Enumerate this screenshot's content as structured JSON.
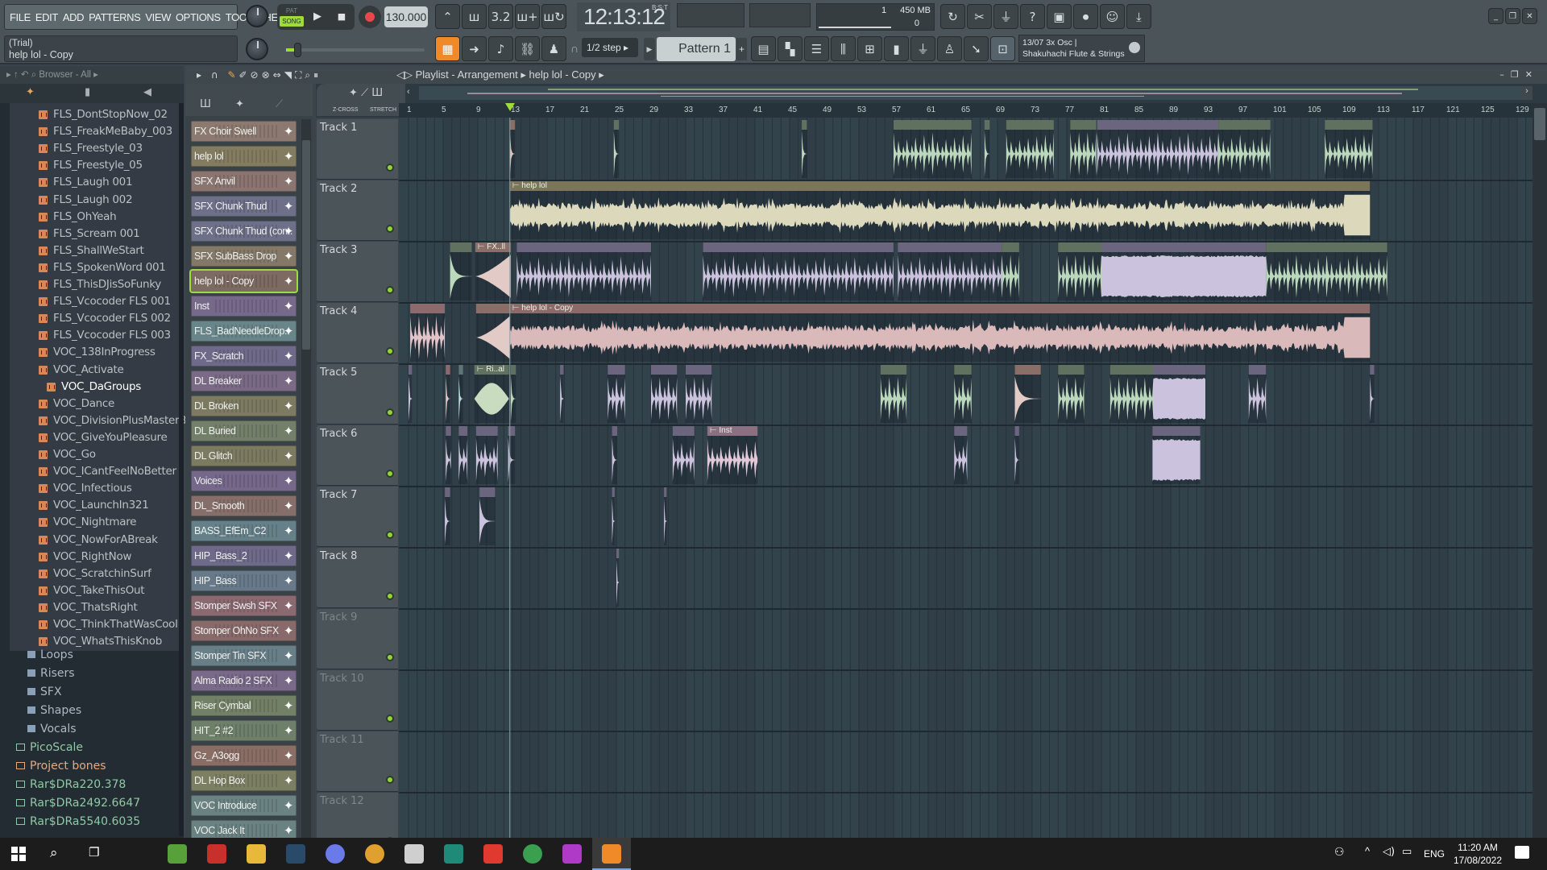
{
  "menu": [
    "FILE",
    "EDIT",
    "ADD",
    "PATTERNS",
    "VIEW",
    "OPTIONS",
    "TOOLS",
    "HELP"
  ],
  "transport": {
    "pat": "PAT",
    "song": "SONG",
    "tempo": "130.000",
    "time": "12:13:12",
    "time_label": "B:S:T"
  },
  "cpu": {
    "cpu_value": "1",
    "memory": "450 MB",
    "polyphony": "0"
  },
  "hint": {
    "line1": "(Trial)",
    "line2": "help lol - Copy"
  },
  "snap": "1/2 step",
  "pattern": "Pattern 1",
  "news": {
    "line1": "13/07  3x Osc |",
    "line2": "Shakuhachi Flute & Strings"
  },
  "browser": {
    "title": "Browser - All",
    "items": [
      "FLS_DontStopNow_02",
      "FLS_FreakMeBaby_003",
      "FLS_Freestyle_03",
      "FLS_Freestyle_05",
      "FLS_Laugh 001",
      "FLS_Laugh 002",
      "FLS_OhYeah",
      "FLS_Scream 001",
      "FLS_ShallWeStart",
      "FLS_SpokenWord 001",
      "FLS_ThisDJisSoFunky",
      "FLS_Vcocoder FLS 001",
      "FLS_Vcocoder FLS 002",
      "FLS_Vcocoder FLS 003",
      "VOC_138InProgress",
      "VOC_Activate",
      "VOC_DaGroups",
      "VOC_Dance",
      "VOC_DivisionPlusMasterBeat",
      "VOC_GiveYouPleasure",
      "VOC_Go",
      "VOC_ICantFeelNoBetter",
      "VOC_Infectious",
      "VOC_LaunchIn321",
      "VOC_Nightmare",
      "VOC_NowForABreak",
      "VOC_RightNow",
      "VOC_ScratchinSurf",
      "VOC_TakeThisOut",
      "VOC_ThatsRight",
      "VOC_ThinkThatWasCool",
      "VOC_WhatsThisKnob"
    ],
    "selected": "VOC_DaGroups",
    "subfolders": [
      "Loops",
      "Risers",
      "SFX",
      "Shapes",
      "Vocals"
    ],
    "folders": [
      {
        "name": "PicoScale",
        "color": "#8fcaa6"
      },
      {
        "name": "Project bones",
        "color": "#e3aa82"
      },
      {
        "name": "Rar$DRa220.378",
        "color": "#8fcaa6"
      },
      {
        "name": "Rar$DRa2492.6647",
        "color": "#8fcaa6"
      },
      {
        "name": "Rar$DRa5540.6035",
        "color": "#8fcaa6"
      }
    ]
  },
  "channels": [
    {
      "name": "FX Choir Swell",
      "color": "#8c7a70"
    },
    {
      "name": "help lol",
      "color": "#837c60"
    },
    {
      "name": "SFX Anvil",
      "color": "#8a7570"
    },
    {
      "name": "SFX Chunk Thud",
      "color": "#6e6f88"
    },
    {
      "name": "SFX Chunk Thud (con..",
      "color": "#6e6f88"
    },
    {
      "name": "SFX SubBass Drop",
      "color": "#847969"
    },
    {
      "name": "help lol - Copy",
      "color": "#7d6a63",
      "selected": true
    },
    {
      "name": "Inst",
      "color": "#76698a"
    },
    {
      "name": "FLS_BadNeedleDrop..",
      "color": "#68868a"
    },
    {
      "name": "FX_Scratch",
      "color": "#6f6a8a"
    },
    {
      "name": "DL Breaker",
      "color": "#7a6a86"
    },
    {
      "name": "DL Broken",
      "color": "#7d7a62"
    },
    {
      "name": "DL Buried",
      "color": "#737f69"
    },
    {
      "name": "DL Glitch",
      "color": "#7d7a62"
    },
    {
      "name": "Voices",
      "color": "#75688a"
    },
    {
      "name": "DL_Smooth",
      "color": "#866f6b"
    },
    {
      "name": "BASS_EfEm_C2",
      "color": "#66808a"
    },
    {
      "name": "HIP_Bass_2",
      "color": "#6f6a8a"
    },
    {
      "name": "HIP_Bass",
      "color": "#687a8a"
    },
    {
      "name": "Stomper Swsh SFX",
      "color": "#8a6a70"
    },
    {
      "name": "Stomper OhNo SFX",
      "color": "#896a6a"
    },
    {
      "name": "Stomper Tin SFX",
      "color": "#687f88"
    },
    {
      "name": "Alma Radio 2 SFX",
      "color": "#7a6a8a"
    },
    {
      "name": "Riser Cymbal",
      "color": "#728066"
    },
    {
      "name": "HIT_2 #2",
      "color": "#6f806a"
    },
    {
      "name": "Gz_A3ogg",
      "color": "#8a6e66"
    },
    {
      "name": "DL Hop Box",
      "color": "#7c7f62"
    },
    {
      "name": "VOC Introduce",
      "color": "#6a8282"
    },
    {
      "name": "VOC Jack It",
      "color": "#6a8282"
    }
  ],
  "playlist": {
    "title": "Playlist - Arrangement",
    "pattern": "help lol - Copy",
    "zcross": "Z-CROSS",
    "stretch": "STRETCH",
    "tracks": [
      "Track 1",
      "Track 2",
      "Track 3",
      "Track 4",
      "Track 5",
      "Track 6",
      "Track 7",
      "Track 8",
      "Track 9",
      "Track 10",
      "Track 11",
      "Track 12"
    ],
    "ruler": [
      "1",
      "5",
      "9",
      "13",
      "17",
      "21",
      "25",
      "29",
      "33",
      "37",
      "41",
      "45",
      "49",
      "53",
      "57",
      "61",
      "65",
      "69",
      "73",
      "77",
      "81",
      "85",
      "89",
      "93",
      "97",
      "101",
      "105",
      "109",
      "113",
      "117",
      "121",
      "125",
      "129"
    ],
    "playhead_bar": 12.7,
    "clips": [
      {
        "t": 1,
        "s": 12.7,
        "l": 0.6,
        "sh": "hit",
        "c": "#e0c4c0",
        "h": "#8a6e68",
        "label": ""
      },
      {
        "t": 1,
        "s": 24.7,
        "l": 0.6,
        "sh": "hit",
        "c": "#bcd8bc",
        "h": "#60725f",
        "label": ""
      },
      {
        "t": 1,
        "s": 46.4,
        "l": 0.6,
        "sh": "hit",
        "c": "#bcd8bc",
        "h": "#60725f",
        "label": ""
      },
      {
        "t": 1,
        "s": 57,
        "l": 9,
        "sh": "dense",
        "c": "#bcd8bc",
        "h": "#60725f",
        "label": ""
      },
      {
        "t": 1,
        "s": 67.5,
        "l": 0.6,
        "sh": "hit",
        "c": "#bcd8bc",
        "h": "#60725f",
        "label": ""
      },
      {
        "t": 1,
        "s": 70,
        "l": 5.5,
        "sh": "dense",
        "c": "#bcd8bc",
        "h": "#60725f",
        "label": ""
      },
      {
        "t": 1,
        "s": 77.4,
        "l": 3,
        "sh": "dense",
        "c": "#bcd8bc",
        "h": "#60725f",
        "label": ""
      },
      {
        "t": 1,
        "s": 80.5,
        "l": 14,
        "sh": "dense",
        "c": "#cbc3dd",
        "h": "#6c6580",
        "label": ""
      },
      {
        "t": 1,
        "s": 94.5,
        "l": 6,
        "sh": "dense",
        "c": "#bcd8bc",
        "h": "#60725f",
        "label": ""
      },
      {
        "t": 1,
        "s": 106.8,
        "l": 5.5,
        "sh": "dense",
        "c": "#bcd8bc",
        "h": "#60725f",
        "label": ""
      },
      {
        "t": 2,
        "s": 12.7,
        "l": 99.3,
        "sh": "wave",
        "c": "#dcd8bc",
        "h": "#7b7659",
        "label": "help lol"
      },
      {
        "t": 3,
        "s": 5.8,
        "l": 2.5,
        "sh": "hit",
        "c": "#bcd8bc",
        "h": "#60725f",
        "label": ""
      },
      {
        "t": 3,
        "s": 8.7,
        "l": 4.1,
        "sh": "rise",
        "c": "#e2cbc6",
        "h": "#8a6e68",
        "label": "FX..ll"
      },
      {
        "t": 3,
        "s": 13.5,
        "l": 15.5,
        "sh": "dense",
        "c": "#cbc3dd",
        "h": "#6c6580",
        "label": ""
      },
      {
        "t": 3,
        "s": 35,
        "l": 22,
        "sh": "dense",
        "c": "#cbc3dd",
        "h": "#6c6580",
        "label": ""
      },
      {
        "t": 3,
        "s": 57.5,
        "l": 12,
        "sh": "dense",
        "c": "#cbc3dd",
        "h": "#6c6580",
        "label": ""
      },
      {
        "t": 3,
        "s": 69.5,
        "l": 2,
        "sh": "dense",
        "c": "#bcd8bc",
        "h": "#60725f",
        "label": ""
      },
      {
        "t": 3,
        "s": 76,
        "l": 5,
        "sh": "dense",
        "c": "#bcd8bc",
        "h": "#60725f",
        "label": ""
      },
      {
        "t": 3,
        "s": 81,
        "l": 19,
        "sh": "block",
        "c": "#cbc3dd",
        "h": "#6c6580",
        "label": ""
      },
      {
        "t": 3,
        "s": 100,
        "l": 14,
        "sh": "dense",
        "c": "#bcd8bc",
        "h": "#60725f",
        "label": ""
      },
      {
        "t": 4,
        "s": 1.2,
        "l": 4,
        "sh": "dense",
        "c": "#e2c4c8",
        "h": "#8d6a6c",
        "label": ""
      },
      {
        "t": 4,
        "s": 8.8,
        "l": 3.9,
        "sh": "rise",
        "c": "#e2cbc6",
        "h": "#8a6e68",
        "label": ""
      },
      {
        "t": 4,
        "s": 12.7,
        "l": 99.3,
        "sh": "wave",
        "c": "#d9b9b9",
        "h": "#8a6b68",
        "label": "help lol - Copy"
      },
      {
        "t": 5,
        "s": 1,
        "l": 0.4,
        "sh": "hit",
        "c": "#cbc3dd",
        "h": "#6c6580",
        "label": ""
      },
      {
        "t": 5,
        "s": 5.3,
        "l": 0.5,
        "sh": "hit",
        "c": "#e2c4c8",
        "h": "#8d6a6c",
        "label": ""
      },
      {
        "t": 5,
        "s": 6.8,
        "l": 0.5,
        "sh": "hit",
        "c": "#b8d8d8",
        "h": "#5e7676",
        "label": ""
      },
      {
        "t": 5,
        "s": 8.6,
        "l": 4,
        "sh": "swell",
        "c": "#c8dcc0",
        "h": "#60725f",
        "label": "Ri..al"
      },
      {
        "t": 5,
        "s": 12.8,
        "l": 0.6,
        "sh": "hit",
        "c": "#bcd8bc",
        "h": "#60725f",
        "label": ""
      },
      {
        "t": 5,
        "s": 18.5,
        "l": 0.4,
        "sh": "hit",
        "c": "#cbc3dd",
        "h": "#6c6580",
        "label": ""
      },
      {
        "t": 5,
        "s": 24,
        "l": 2,
        "sh": "dense",
        "c": "#cbc3dd",
        "h": "#6c6580",
        "label": ""
      },
      {
        "t": 5,
        "s": 29,
        "l": 3,
        "sh": "dense",
        "c": "#cbc3dd",
        "h": "#6c6580",
        "label": ""
      },
      {
        "t": 5,
        "s": 33,
        "l": 3,
        "sh": "dense",
        "c": "#cbc3dd",
        "h": "#6c6580",
        "label": ""
      },
      {
        "t": 5,
        "s": 55.5,
        "l": 3,
        "sh": "dense",
        "c": "#bcd8bc",
        "h": "#60725f",
        "label": ""
      },
      {
        "t": 5,
        "s": 64,
        "l": 2,
        "sh": "dense",
        "c": "#bcd8bc",
        "h": "#60725f",
        "label": ""
      },
      {
        "t": 5,
        "s": 71,
        "l": 3,
        "sh": "hit",
        "c": "#e2cbc6",
        "h": "#8a6e68",
        "label": ""
      },
      {
        "t": 5,
        "s": 76,
        "l": 3,
        "sh": "dense",
        "c": "#bcd8bc",
        "h": "#60725f",
        "label": ""
      },
      {
        "t": 5,
        "s": 82,
        "l": 5,
        "sh": "dense",
        "c": "#bcd8bc",
        "h": "#60725f",
        "label": ""
      },
      {
        "t": 5,
        "s": 87,
        "l": 6,
        "sh": "block",
        "c": "#cbc3dd",
        "h": "#6c6580",
        "label": ""
      },
      {
        "t": 5,
        "s": 98,
        "l": 2,
        "sh": "dense",
        "c": "#cbc3dd",
        "h": "#6c6580",
        "label": ""
      },
      {
        "t": 5,
        "s": 112,
        "l": 0.5,
        "sh": "hit",
        "c": "#cbc3dd",
        "h": "#6c6580",
        "label": ""
      },
      {
        "t": 6,
        "s": 5.3,
        "l": 0.6,
        "sh": "dense",
        "c": "#cbc3dd",
        "h": "#6c6580",
        "label": ""
      },
      {
        "t": 6,
        "s": 6.8,
        "l": 1,
        "sh": "dense",
        "c": "#cbc3dd",
        "h": "#6c6580",
        "label": ""
      },
      {
        "t": 6,
        "s": 8.8,
        "l": 2.5,
        "sh": "dense",
        "c": "#cbc3dd",
        "h": "#6c6580",
        "label": ""
      },
      {
        "t": 6,
        "s": 12.5,
        "l": 0.8,
        "sh": "hit",
        "c": "#cbc3dd",
        "h": "#6c6580",
        "label": ""
      },
      {
        "t": 6,
        "s": 24.5,
        "l": 0.6,
        "sh": "hit",
        "c": "#cbc3dd",
        "h": "#6c6580",
        "label": ""
      },
      {
        "t": 6,
        "s": 31.5,
        "l": 2.5,
        "sh": "dense",
        "c": "#cbc3dd",
        "h": "#6c6580",
        "label": ""
      },
      {
        "t": 6,
        "s": 35.5,
        "l": 5.8,
        "sh": "dense",
        "c": "#e0c8d8",
        "h": "#8a7080",
        "label": "Inst"
      },
      {
        "t": 6,
        "s": 64,
        "l": 1.5,
        "sh": "dense",
        "c": "#cbc3dd",
        "h": "#6c6580",
        "label": ""
      },
      {
        "t": 6,
        "s": 71,
        "l": 0.5,
        "sh": "hit",
        "c": "#cbc3dd",
        "h": "#6c6580",
        "label": ""
      },
      {
        "t": 6,
        "s": 86.9,
        "l": 5.5,
        "sh": "block",
        "c": "#cbc3dd",
        "h": "#6c6580",
        "label": ""
      },
      {
        "t": 7,
        "s": 5.2,
        "l": 0.6,
        "sh": "hit",
        "c": "#cbc3dd",
        "h": "#6c6580",
        "label": ""
      },
      {
        "t": 7,
        "s": 9.2,
        "l": 1.8,
        "sh": "hit",
        "c": "#cbc3dd",
        "h": "#6c6580",
        "label": ""
      },
      {
        "t": 7,
        "s": 24.5,
        "l": 0.3,
        "sh": "hit",
        "c": "#cbc3dd",
        "h": "#6c6580",
        "label": ""
      },
      {
        "t": 7,
        "s": 30.5,
        "l": 0.3,
        "sh": "hit",
        "c": "#cbc3dd",
        "h": "#6c6580",
        "label": ""
      },
      {
        "t": 8,
        "s": 25,
        "l": 0.3,
        "sh": "hit",
        "c": "#cbc3dd",
        "h": "#6c6580",
        "label": ""
      }
    ]
  },
  "taskbar": {
    "time": "11:20 AM",
    "date": "17/08/2022",
    "lang": "ENG",
    "apps": [
      {
        "name": "app-1",
        "color": "#58a03a"
      },
      {
        "name": "app-2",
        "color": "#c8302c"
      },
      {
        "name": "file-explorer",
        "color": "#e8b83a"
      },
      {
        "name": "app-4",
        "color": "#2a4a6a"
      },
      {
        "name": "discord",
        "color": "#6a7ae8"
      },
      {
        "name": "chrome",
        "color": "#e0a030"
      },
      {
        "name": "settings",
        "color": "#cfcfcf"
      },
      {
        "name": "publisher",
        "color": "#1f8a78"
      },
      {
        "name": "wps",
        "color": "#e03a30"
      },
      {
        "name": "chrome-2",
        "color": "#3aa050"
      },
      {
        "name": "app-11",
        "color": "#b03ac8"
      },
      {
        "name": "fl-studio",
        "color": "#f08a28"
      }
    ]
  }
}
